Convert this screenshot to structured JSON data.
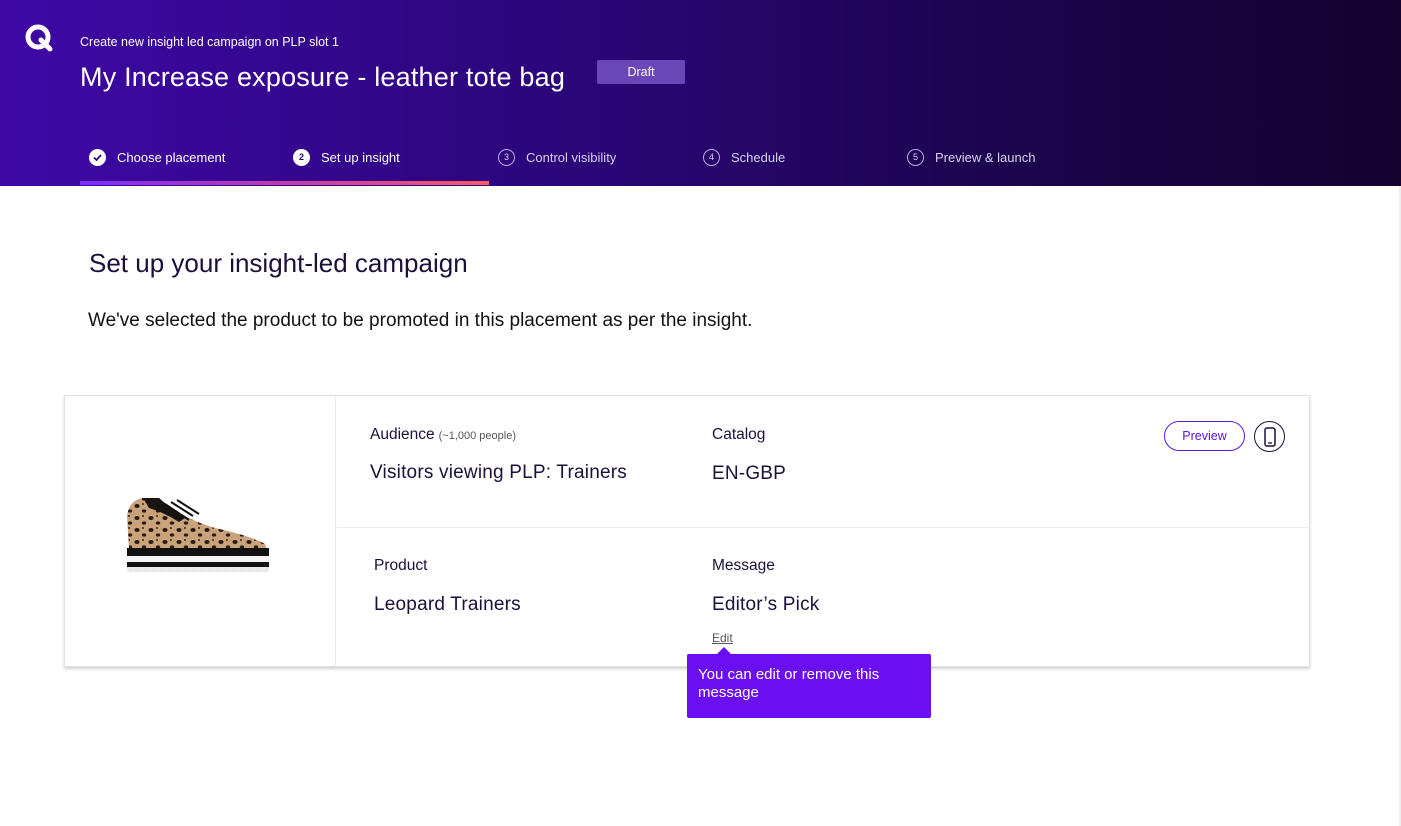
{
  "header": {
    "logo_icon": "q-logo-icon",
    "subtitle": "Create new insight led campaign on PLP slot 1",
    "title": "My Increase exposure - leather tote bag",
    "status_badge": "Draft",
    "colors": {
      "gradient_start": "#3f08a6",
      "gradient_end": "#12032f"
    }
  },
  "steps": [
    {
      "num": "",
      "label": "Choose placement",
      "state": "done",
      "icon": "checkmark-icon"
    },
    {
      "num": "2",
      "label": "Set up insight",
      "state": "active"
    },
    {
      "num": "3",
      "label": "Control visibility",
      "state": "pending"
    },
    {
      "num": "4",
      "label": "Schedule",
      "state": "pending"
    },
    {
      "num": "5",
      "label": "Preview & launch",
      "state": "pending"
    }
  ],
  "main": {
    "heading": "Set up your insight-led campaign",
    "lead": "We've selected the product to be promoted in this placement as per the insight."
  },
  "card": {
    "product_image_icon": "leopard-trainer-image",
    "audience": {
      "label": "Audience",
      "note": "(~1,000 people)",
      "value": "Visitors viewing PLP: Trainers"
    },
    "catalog": {
      "label": "Catalog",
      "value": "EN-GBP"
    },
    "product": {
      "label": "Product",
      "value": "Leopard Trainers"
    },
    "message": {
      "label": "Message",
      "value": "Editor’s Pick",
      "edit_label": "Edit"
    },
    "preview_button": "Preview",
    "device_icon": "mobile-phone-icon",
    "accent_color": "#5a17e6"
  },
  "tooltip": {
    "text": "You can edit or remove this message",
    "color": "#6b0ef2"
  }
}
